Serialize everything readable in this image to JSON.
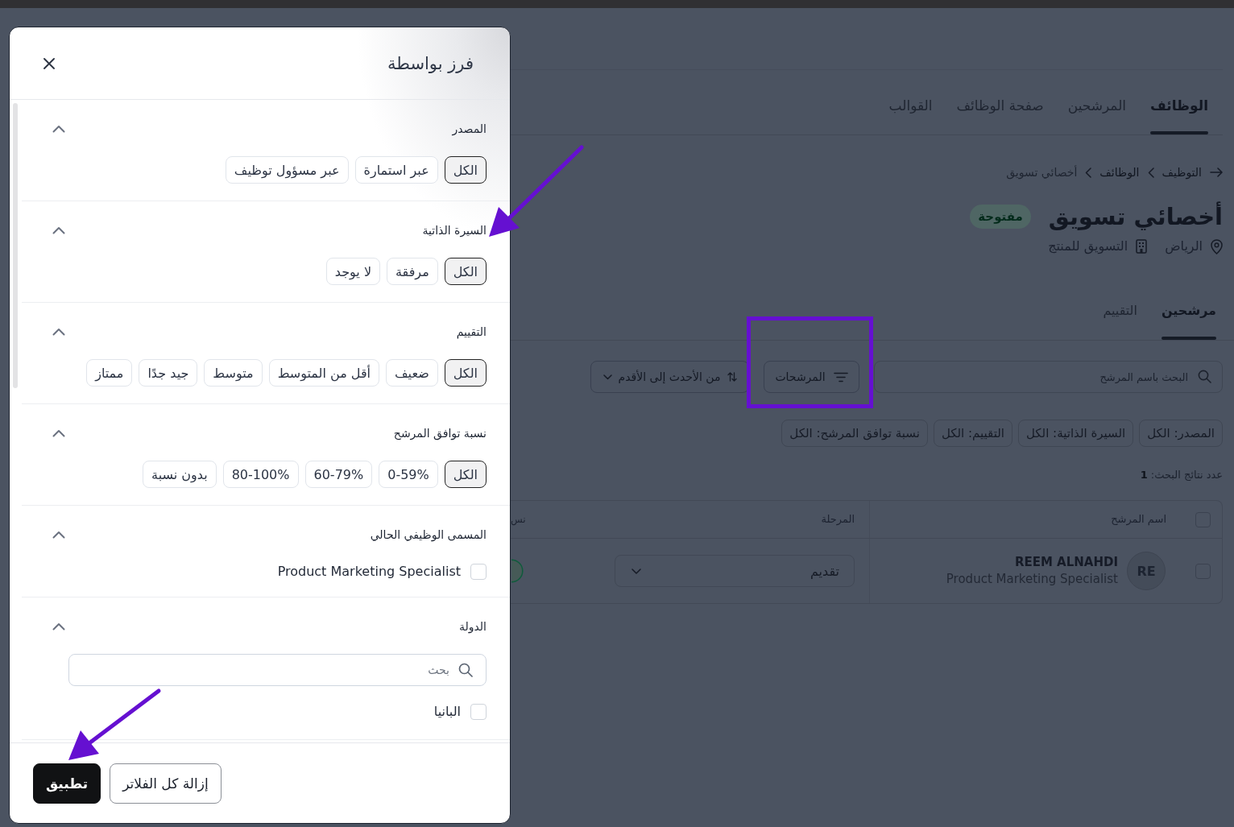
{
  "top_nav": {
    "tabs": [
      {
        "label": "الوظائف",
        "selected": true
      },
      {
        "label": "المرشحين",
        "selected": false
      },
      {
        "label": "صفحة الوظائف",
        "selected": false
      },
      {
        "label": "القوالب",
        "selected": false
      }
    ]
  },
  "breadcrumb": [
    {
      "label": "التوظيف",
      "current": false
    },
    {
      "label": "الوظائف",
      "current": false
    },
    {
      "label": "أخصائي تسويق",
      "current": true
    }
  ],
  "job": {
    "title": "أخصائي تسويق",
    "status": "مفتوحة",
    "location": "الرياض",
    "department": "التسويق للمنتج"
  },
  "sub_tabs": [
    {
      "label": "مرشحين",
      "selected": true
    },
    {
      "label": "التقييم",
      "selected": false
    }
  ],
  "toolbar": {
    "search": {
      "placeholder": "البحث باسم المرشح"
    },
    "filters_button": "المرشحات",
    "sort_button": "من الأحدث إلى الأقدم"
  },
  "active_filters": [
    "المصدر: الكل",
    "السيرة الذاتية: الكل",
    "التقييم: الكل",
    "نسبة توافق المرشح: الكل"
  ],
  "results": "عدد نتائج البحث: **1**",
  "table": {
    "columns": [
      "اسم المرشح",
      "المرحلة",
      "نس"
    ],
    "header_checked": false,
    "rows": [
      {
        "checked": false,
        "initials": "RE",
        "name": "REEM ALNAHDI",
        "job_title": "Product Marketing Specialist",
        "stage": "تقديم"
      }
    ]
  },
  "modal": {
    "title": "فرز بواسطة",
    "sections": [
      {
        "kind": "chips",
        "label": "المصدر",
        "expanded": true,
        "options": [
          {
            "label": "الكل",
            "selected": true
          },
          {
            "label": "عبر استمارة",
            "selected": false
          },
          {
            "label": "عبر مسؤول توظيف",
            "selected": false
          }
        ]
      },
      {
        "kind": "chips",
        "label": "السيرة الذاتية",
        "expanded": true,
        "options": [
          {
            "label": "الكل",
            "selected": true
          },
          {
            "label": "مرفقة",
            "selected": false
          },
          {
            "label": "لا يوجد",
            "selected": false
          }
        ]
      },
      {
        "kind": "chips",
        "label": "التقييم",
        "expanded": true,
        "options": [
          {
            "label": "الكل",
            "selected": true
          },
          {
            "label": "ضعيف",
            "selected": false
          },
          {
            "label": "أقل من المتوسط",
            "selected": false
          },
          {
            "label": "متوسط",
            "selected": false
          },
          {
            "label": "جيد جدًا",
            "selected": false
          },
          {
            "label": "ممتاز",
            "selected": false
          }
        ]
      },
      {
        "kind": "chips",
        "label": "نسبة توافق المرشح",
        "expanded": true,
        "options": [
          {
            "label": "الكل",
            "selected": true
          },
          {
            "label": "0-59%",
            "selected": false
          },
          {
            "label": "60-79%",
            "selected": false
          },
          {
            "label": "80-100%",
            "selected": false
          },
          {
            "label": "بدون نسبة",
            "selected": false
          }
        ]
      },
      {
        "kind": "checklist",
        "label": "المسمى الوظيفي الحالي",
        "expanded": true,
        "items": [
          {
            "label": "Product Marketing Specialist",
            "checked": false
          }
        ]
      },
      {
        "kind": "search_checklist",
        "label": "الدولة",
        "expanded": true,
        "search": {
          "placeholder": "بحث"
        },
        "items": [
          {
            "label": "البانيا",
            "checked": false
          }
        ]
      }
    ],
    "buttons": [
      {
        "label": "إزالة كل الفلاتر",
        "kind": "secondary"
      },
      {
        "label": "تطبيق",
        "kind": "primary"
      }
    ]
  }
}
